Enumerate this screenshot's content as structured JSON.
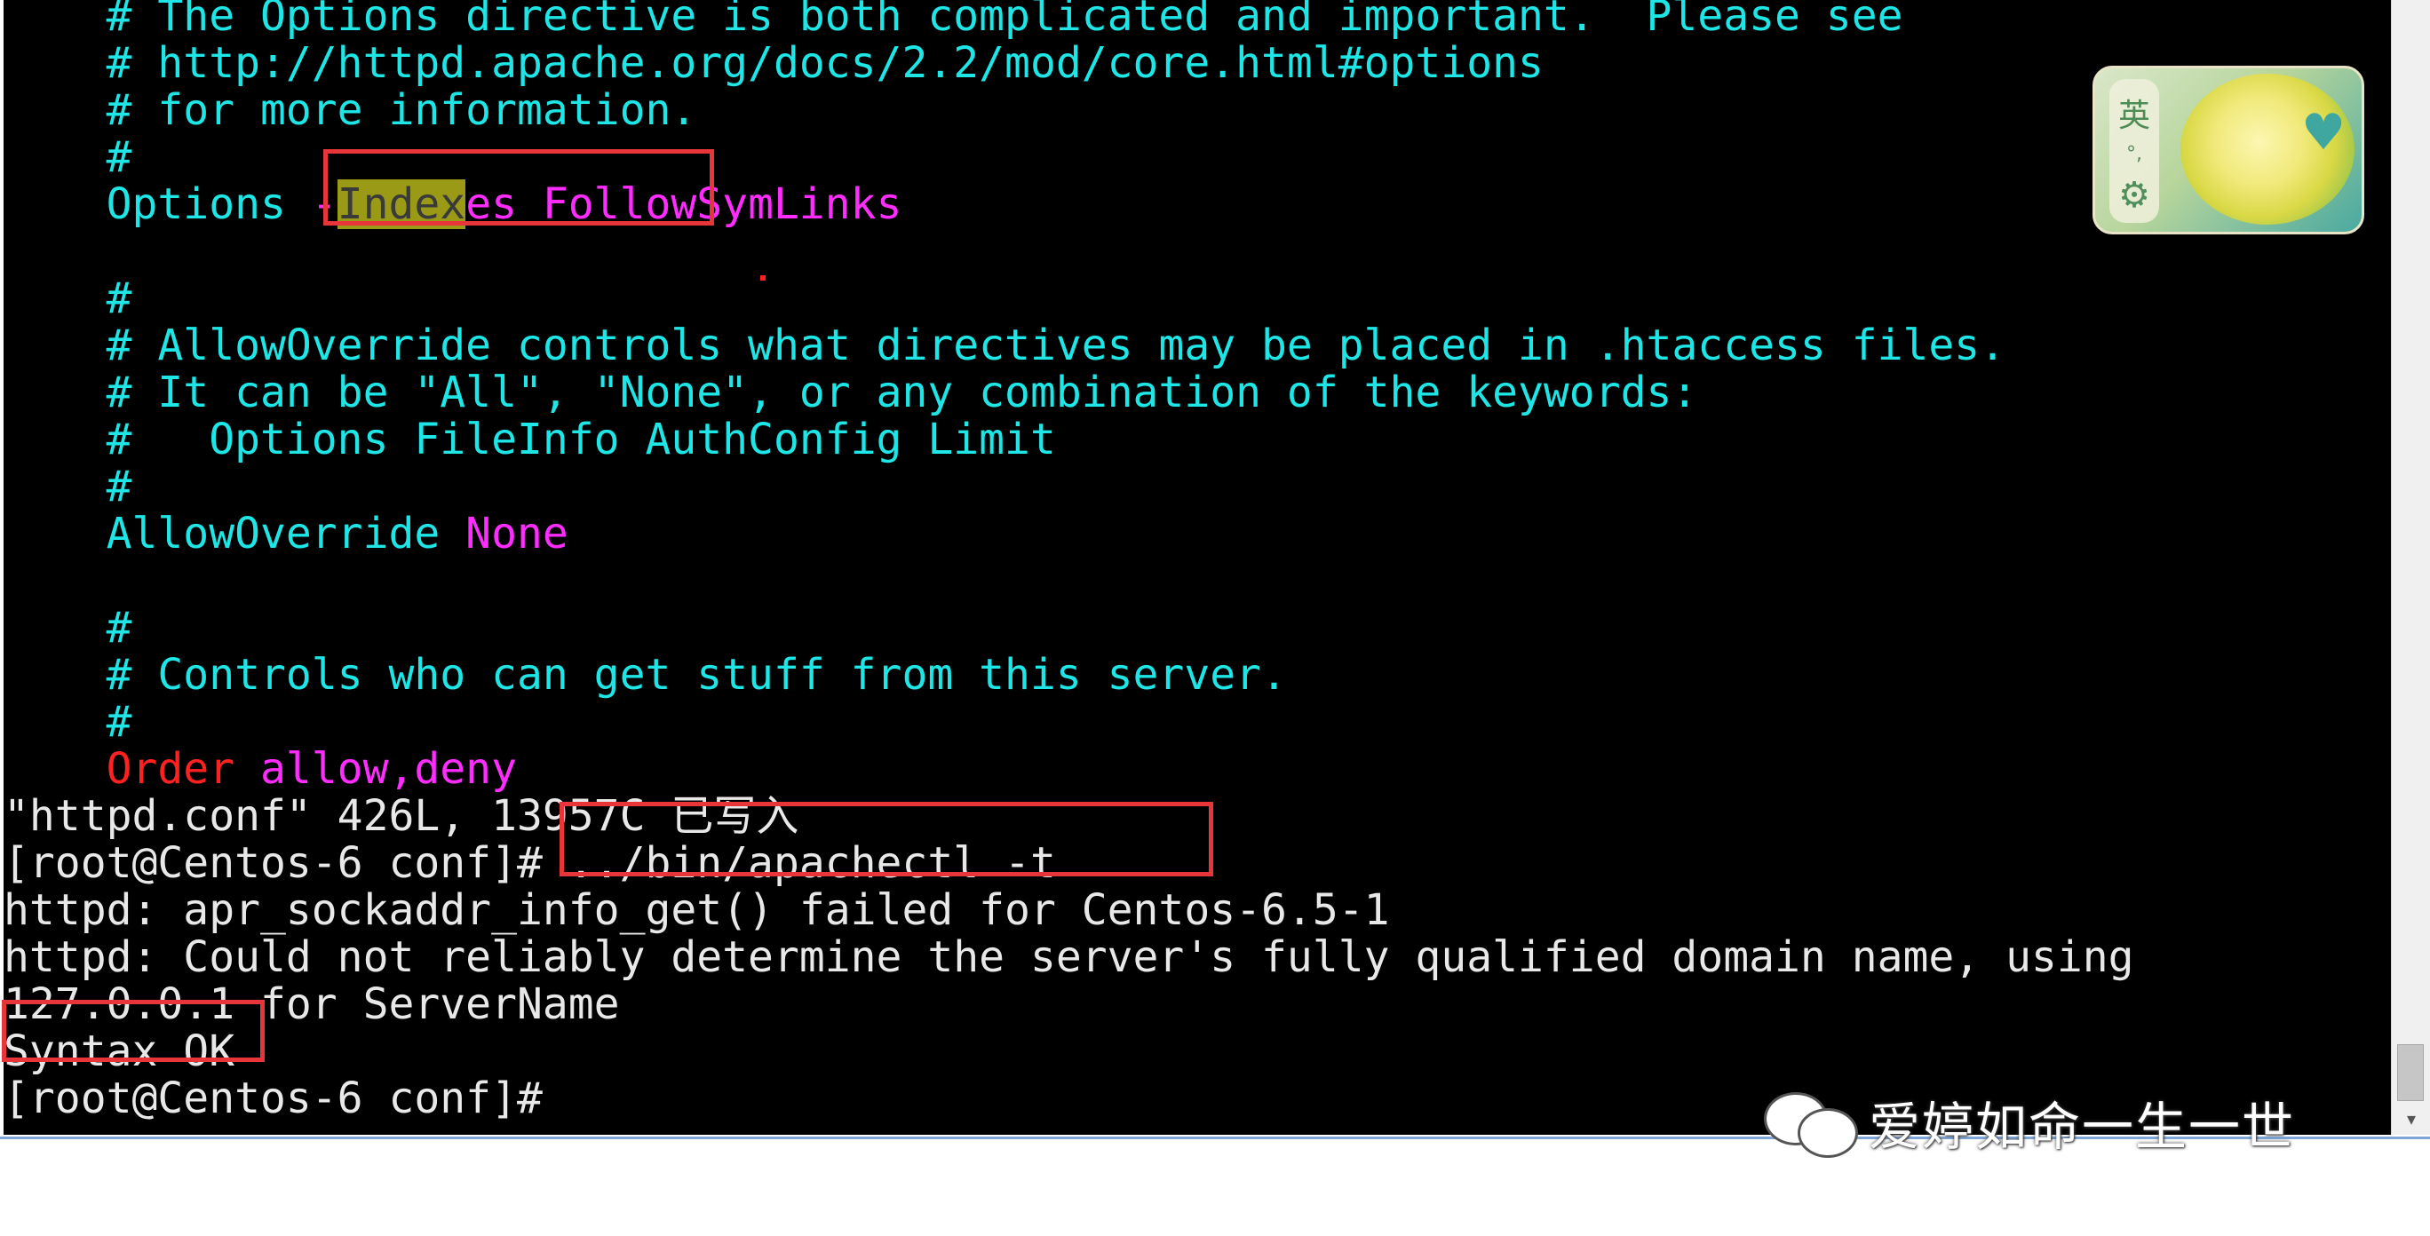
{
  "terminal": {
    "lines": [
      {
        "segments": [
          {
            "text": "    # The Options directive is both complicated and important.  Please see",
            "color": "cyan"
          }
        ]
      },
      {
        "segments": [
          {
            "text": "    # http://httpd.apache.org/docs/2.2/mod/core.html#options",
            "color": "cyan"
          }
        ]
      },
      {
        "segments": [
          {
            "text": "    # for more information.",
            "color": "cyan"
          }
        ]
      },
      {
        "segments": [
          {
            "text": "    #",
            "color": "cyan"
          }
        ]
      },
      {
        "segments": [
          {
            "text": "    Options ",
            "color": "cyan"
          },
          {
            "text": "-",
            "color": "magenta"
          },
          {
            "text": "Indexes",
            "color": "magenta",
            "highlight": "Index"
          },
          {
            "text": " FollowSymLinks",
            "color": "magenta"
          }
        ]
      },
      {
        "segments": [
          {
            "text": "",
            "color": "cyan"
          }
        ]
      },
      {
        "segments": [
          {
            "text": "    #",
            "color": "cyan"
          }
        ]
      },
      {
        "segments": [
          {
            "text": "    # AllowOverride controls what directives may be placed in .htaccess files.",
            "color": "cyan"
          }
        ]
      },
      {
        "segments": [
          {
            "text": "    # It can be \"All\", \"None\", or any combination of the keywords:",
            "color": "cyan"
          }
        ]
      },
      {
        "segments": [
          {
            "text": "    #   Options FileInfo AuthConfig Limit",
            "color": "cyan"
          }
        ]
      },
      {
        "segments": [
          {
            "text": "    #",
            "color": "cyan"
          }
        ]
      },
      {
        "segments": [
          {
            "text": "    AllowOverride ",
            "color": "cyan"
          },
          {
            "text": "None",
            "color": "magenta"
          }
        ]
      },
      {
        "segments": [
          {
            "text": "",
            "color": "cyan"
          }
        ]
      },
      {
        "segments": [
          {
            "text": "    #",
            "color": "cyan"
          }
        ]
      },
      {
        "segments": [
          {
            "text": "    # Controls who can get stuff from this server.",
            "color": "cyan"
          }
        ]
      },
      {
        "segments": [
          {
            "text": "    #",
            "color": "cyan"
          }
        ]
      },
      {
        "segments": [
          {
            "text": "    Order ",
            "color": "red"
          },
          {
            "text": "allow,deny",
            "color": "magenta"
          }
        ]
      },
      {
        "segments": [
          {
            "text": "\"httpd.conf\" 426L, 13957C 已写入",
            "color": "white"
          }
        ]
      },
      {
        "segments": [
          {
            "text": "[root@Centos-6 conf]# ../bin/apachectl -t",
            "color": "white"
          }
        ]
      },
      {
        "segments": [
          {
            "text": "httpd: apr_sockaddr_info_get() failed for Centos-6.5-1",
            "color": "white"
          }
        ]
      },
      {
        "segments": [
          {
            "text": "httpd: Could not reliably determine the server's fully qualified domain name, using",
            "color": "white"
          }
        ]
      },
      {
        "segments": [
          {
            "text": "127.0.0.1 for ServerName",
            "color": "white"
          }
        ]
      },
      {
        "segments": [
          {
            "text": "Syntax OK",
            "color": "white"
          }
        ]
      },
      {
        "segments": [
          {
            "text": "[root@Centos-6 conf]#",
            "color": "white"
          }
        ]
      }
    ]
  },
  "ime_widget": {
    "mode_label": "英",
    "punct_label": "°,",
    "settings_icon": "gear-icon"
  },
  "watermark": {
    "icon": "wechat-icon",
    "text": "爱婷如命一生一世"
  },
  "colors": {
    "cyan": "#1ee6e6",
    "magenta": "#ff2cff",
    "red": "#ff2020",
    "white": "#e8e8e8",
    "annotation_box": "#e8353a",
    "search_highlight": "#9a9a16"
  }
}
